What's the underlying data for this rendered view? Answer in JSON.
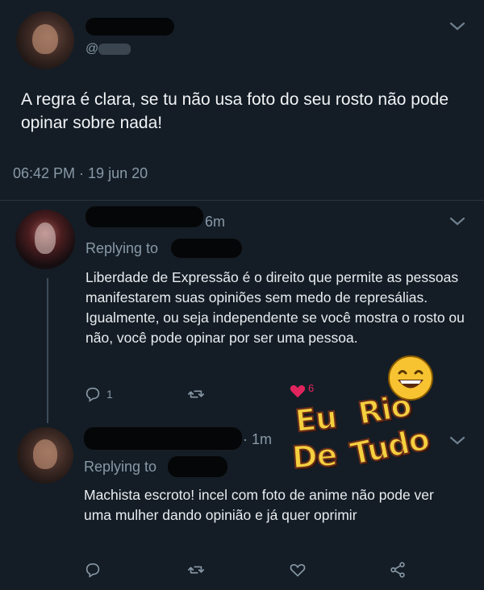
{
  "tweet": {
    "handle": "@",
    "text": "A regra é clara, se tu não usa foto do seu rosto não pode opinar sobre nada!",
    "timestamp": "06:42 PM · 19 jun 20"
  },
  "replies": [
    {
      "time": "6m",
      "replying_to": "Replying to",
      "text": "Liberdade de Expressão é o direito que permite as pessoas manifestarem suas opiniões sem medo de represálias. Igualmente, ou seja independente se você mostra o rosto ou não, você pode opinar por ser uma pessoa.",
      "reply_count": "1",
      "like_count": "6"
    },
    {
      "time": "· 1m",
      "replying_to": "Replying to",
      "text": "Machista escroto! incel com foto de anime não pode ver uma mulher dando opinião e já quer oprimir"
    }
  ],
  "sticker": {
    "line1a": "Eu",
    "line1b": "Rio",
    "line2a": "De",
    "line2b": "Tudo"
  },
  "colors": {
    "background": "#141d26",
    "muted": "#8899a6",
    "like": "#e0245e",
    "sticker": "#f4d03f"
  }
}
